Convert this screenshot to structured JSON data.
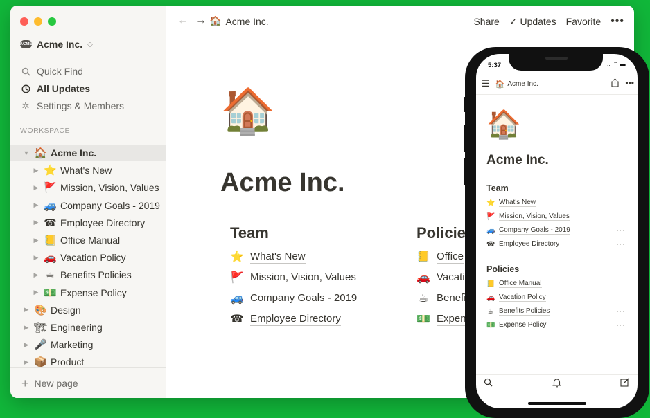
{
  "sidebar": {
    "workspace_name": "Acme Inc.",
    "workspace_logo_text": "ACME",
    "workspace_chevron": "◇",
    "quick_find": "Quick Find",
    "all_updates": "All Updates",
    "settings": "Settings & Members",
    "section_label": "WORKSPACE",
    "tree": [
      {
        "label": "Acme Inc.",
        "emoji": "🏠",
        "level": 0,
        "active": true,
        "expanded": true
      },
      {
        "label": "What's New",
        "emoji": "⭐",
        "level": 1
      },
      {
        "label": "Mission, Vision, Values",
        "emoji": "🚩",
        "level": 1
      },
      {
        "label": "Company Goals - 2019",
        "emoji": "🚙",
        "level": 1
      },
      {
        "label": "Employee Directory",
        "emoji": "☎",
        "level": 1
      },
      {
        "label": "Office Manual",
        "emoji": "📒",
        "level": 1
      },
      {
        "label": "Vacation Policy",
        "emoji": "🚗",
        "level": 1
      },
      {
        "label": "Benefits Policies",
        "emoji": "☕",
        "level": 1
      },
      {
        "label": "Expense Policy",
        "emoji": "💵",
        "level": 1
      },
      {
        "label": "Design",
        "emoji": "🎨",
        "level": 0
      },
      {
        "label": "Engineering",
        "emoji": "🏗",
        "level": 0
      },
      {
        "label": "Marketing",
        "emoji": "🎤",
        "level": 0
      },
      {
        "label": "Product",
        "emoji": "📦",
        "level": 0
      }
    ],
    "new_page": "New page"
  },
  "topbar": {
    "breadcrumb_emoji": "🏠",
    "breadcrumb": "Acme Inc.",
    "share": "Share",
    "updates": "Updates",
    "favorite": "Favorite",
    "more": "•••"
  },
  "page": {
    "icon": "🏠",
    "title": "Acme Inc.",
    "team_heading": "Team",
    "team": [
      {
        "emoji": "⭐",
        "label": "What's New"
      },
      {
        "emoji": "🚩",
        "label": "Mission, Vision, Values"
      },
      {
        "emoji": "🚙",
        "label": "Company Goals - 2019"
      },
      {
        "emoji": "☎",
        "label": "Employee Directory"
      }
    ],
    "policies_heading": "Policie",
    "policies": [
      {
        "emoji": "📒",
        "label": "Office"
      },
      {
        "emoji": "🚗",
        "label": "Vacatio"
      },
      {
        "emoji": "☕",
        "label": "Benefit"
      },
      {
        "emoji": "💵",
        "label": "Expens"
      }
    ]
  },
  "phone": {
    "time": "5:37",
    "status": "... ⌔ ▬",
    "breadcrumb": "Acme Inc.",
    "breadcrumb_emoji": "🏠",
    "icon": "🏠",
    "title": "Acme Inc.",
    "team_heading": "Team",
    "team": [
      {
        "emoji": "⭐",
        "label": "What's New"
      },
      {
        "emoji": "🚩",
        "label": "Mission, Vision, Values"
      },
      {
        "emoji": "🚙",
        "label": "Company Goals - 2019"
      },
      {
        "emoji": "☎",
        "label": "Employee Directory"
      }
    ],
    "policies_heading": "Policies",
    "policies": [
      {
        "emoji": "📒",
        "label": "Office Manual"
      },
      {
        "emoji": "🚗",
        "label": "Vacation Policy"
      },
      {
        "emoji": "☕",
        "label": "Benefits Policies"
      },
      {
        "emoji": "💵",
        "label": "Expense Policy"
      }
    ],
    "row_more": "···"
  },
  "colors": {
    "background": "#11b73a",
    "sidebar": "#f7f6f3",
    "text": "#37352f",
    "muted": "#6b6a66"
  }
}
